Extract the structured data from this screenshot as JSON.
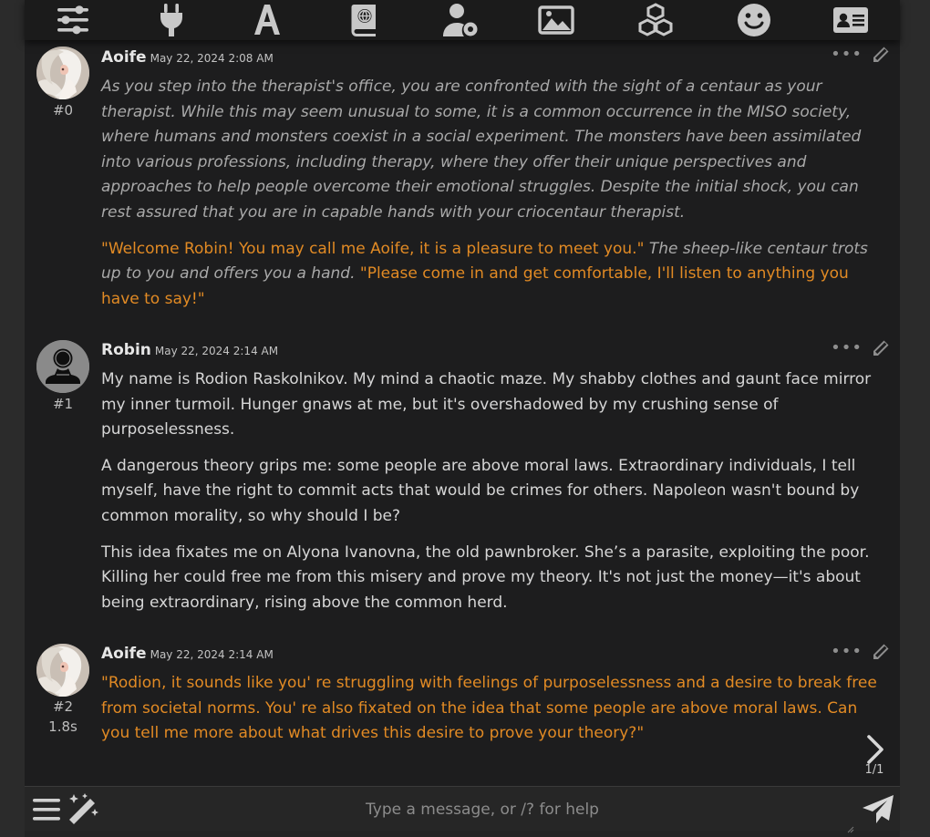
{
  "toolbar": {
    "icons": [
      "sliders-icon",
      "plug-icon",
      "font-icon",
      "book-globe-icon",
      "user-gear-icon",
      "image-icon",
      "cubes-icon",
      "smiley-icon",
      "id-card-icon"
    ]
  },
  "messages": [
    {
      "name": "Aoife",
      "timestamp": "May 22, 2024 2:08 AM",
      "id": "#0",
      "avatar": "aoife-avatar",
      "paragraphs": [
        [
          {
            "style": "ital",
            "text": "As you step into the therapist's office, you are confronted with the sight of a centaur as your therapist. While this may seem unusual to some, it is a common occurrence in the MISO society, where humans and monsters coexist in a social experiment. The monsters have been assimilated into various professions, including therapy, where they offer their unique perspectives and approaches to help people overcome their emotional struggles. Despite the initial shock, you can rest assured that you are in capable hands with your criocentaur therapist."
          }
        ],
        [
          {
            "style": "quote",
            "text": "\"Welcome Robin! You may call me Aoife, it is a pleasure to meet you.\""
          },
          {
            "style": "ital",
            "text": " The sheep-like centaur trots up to you and offers you a hand. "
          },
          {
            "style": "quote",
            "text": "\"Please come in and get comfortable, I'll listen to anything you have to say!\""
          }
        ]
      ]
    },
    {
      "name": "Robin",
      "timestamp": "May 22, 2024 2:14 AM",
      "id": "#1",
      "avatar": "user-silhouette-avatar",
      "paragraphs": [
        [
          {
            "style": "plain",
            "text": "My name is Rodion Raskolnikov. My mind a chaotic maze. My shabby clothes and gaunt face mirror my inner turmoil. Hunger gnaws at me, but it's overshadowed by my crushing sense of purposelessness."
          }
        ],
        [
          {
            "style": "plain",
            "text": "A dangerous theory grips me: some people are above moral laws. Extraordinary individuals, I tell myself, have the right to commit acts that would be crimes for others. Napoleon wasn't bound by common morality, so why should I be?"
          }
        ],
        [
          {
            "style": "plain",
            "text": "This idea fixates me on Alyona Ivanovna, the old pawnbroker. She’s a parasite, exploiting the poor. Killing her could free me from this misery and prove my theory. It's not just the money—it's about being extraordinary, rising above the common herd."
          }
        ]
      ]
    },
    {
      "name": "Aoife",
      "timestamp": "May 22, 2024 2:14 AM",
      "id": "#2",
      "timer": "1.8s",
      "avatar": "aoife-avatar",
      "paragraphs": [
        [
          {
            "style": "quote",
            "text": "\"Rodion, it sounds like you' re struggling with feelings of purposelessness and a desire to break free from societal norms. You' re also fixated on the idea that some people are above moral laws. Can you tell me more about what drives this desire to prove your theory?\""
          }
        ]
      ]
    }
  ],
  "swipe": {
    "counter": "1/1"
  },
  "input": {
    "placeholder": "Type a message, or /? for help"
  },
  "colors": {
    "quote": "#e18a24",
    "narration": "#a9a9a9",
    "background": "#1d1d1e"
  }
}
